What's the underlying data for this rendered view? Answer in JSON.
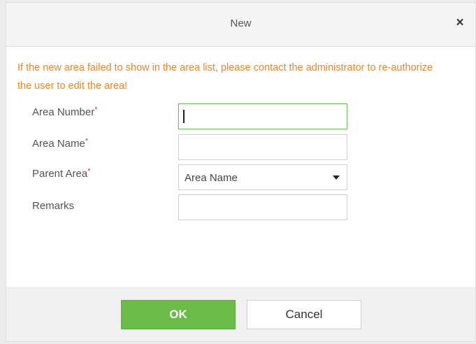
{
  "dialog": {
    "title": "New",
    "close_symbol": "×"
  },
  "warning": "If the new area failed to show in the area list, please contact the administrator to re-authorize the user to edit the area!",
  "form": {
    "required_marker": "*",
    "area_number": {
      "label": "Area Number",
      "value": ""
    },
    "area_name": {
      "label": "Area Name",
      "value": ""
    },
    "parent_area": {
      "label": "Parent Area",
      "selected": "Area Name"
    },
    "remarks": {
      "label": "Remarks",
      "value": ""
    }
  },
  "buttons": {
    "ok": "OK",
    "cancel": "Cancel"
  },
  "colors": {
    "warning": "#e8862a",
    "required": "#e0334b",
    "ok_button": "#6bbb48",
    "focus_border": "#7ab86a"
  }
}
